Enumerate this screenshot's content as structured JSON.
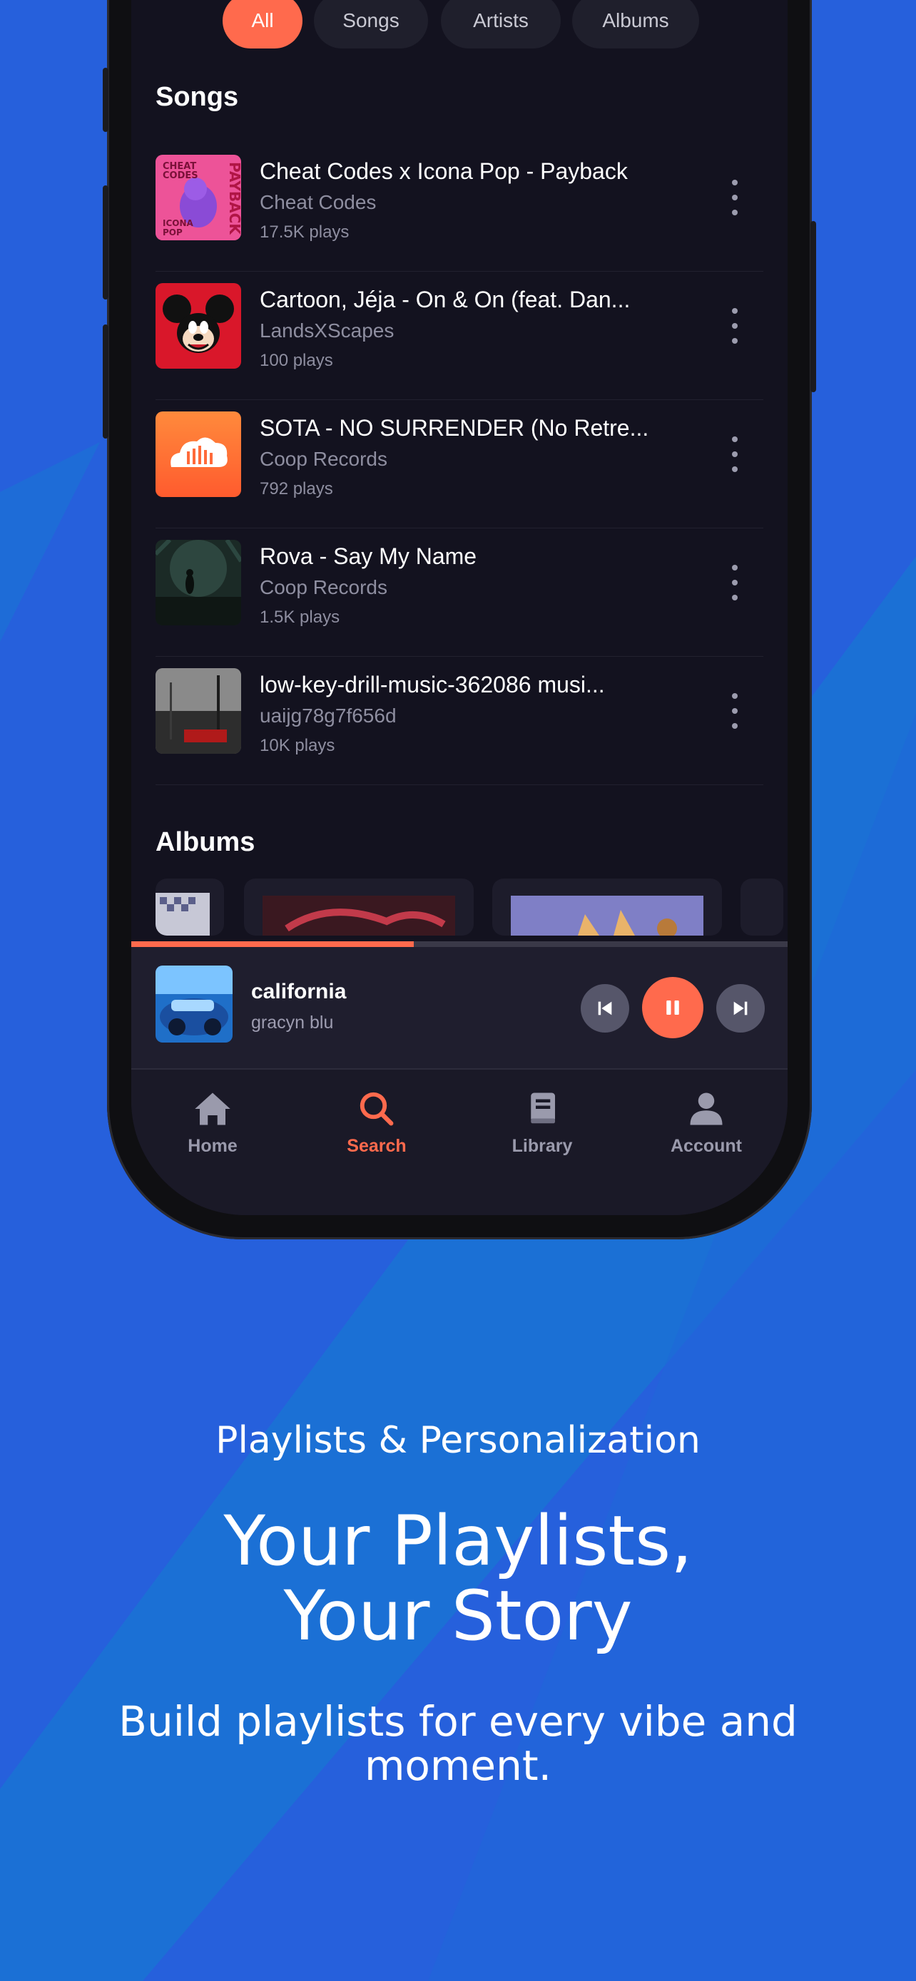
{
  "filters": [
    "All",
    "Songs",
    "Artists",
    "Albums"
  ],
  "songs_section_title": "Songs",
  "songs": [
    {
      "title": "Cheat Codes x Icona Pop - Payback",
      "artist": "Cheat Codes",
      "plays": "17.5K plays",
      "art": "payback"
    },
    {
      "title": "Cartoon, Jéja - On & On (feat. Dan...",
      "artist": "LandsXScapes",
      "plays": "100 plays",
      "art": "mickey"
    },
    {
      "title": "SOTA - NO SURRENDER (No Retre...",
      "artist": "Coop Records",
      "plays": "792 plays",
      "art": "soundcloud"
    },
    {
      "title": "Rova - Say My Name",
      "artist": "Coop Records",
      "plays": "1.5K plays",
      "art": "dark-forest"
    },
    {
      "title": "low-key-drill-music-362086 musi...",
      "artist": "uaijg78g7f656d",
      "plays": "10K plays",
      "art": "low-key"
    }
  ],
  "albums_section_title": "Albums",
  "now_playing": {
    "title": "california",
    "artist": "gracyn blu",
    "progress_percent": 43
  },
  "nav": [
    {
      "label": "Home",
      "icon": "home-icon"
    },
    {
      "label": "Search",
      "icon": "search-icon"
    },
    {
      "label": "Library",
      "icon": "library-icon"
    },
    {
      "label": "Account",
      "icon": "account-icon"
    }
  ],
  "marketing": {
    "eyebrow": "Playlists & Personalization",
    "headline_line1": "Your Playlists,",
    "headline_line2": "Your Story",
    "subtext_line1": "Build playlists for every vibe and",
    "subtext_line2": "moment."
  },
  "colors": {
    "accent": "#ff6a4d",
    "background": "#2660dc",
    "screen": "#13121f"
  }
}
